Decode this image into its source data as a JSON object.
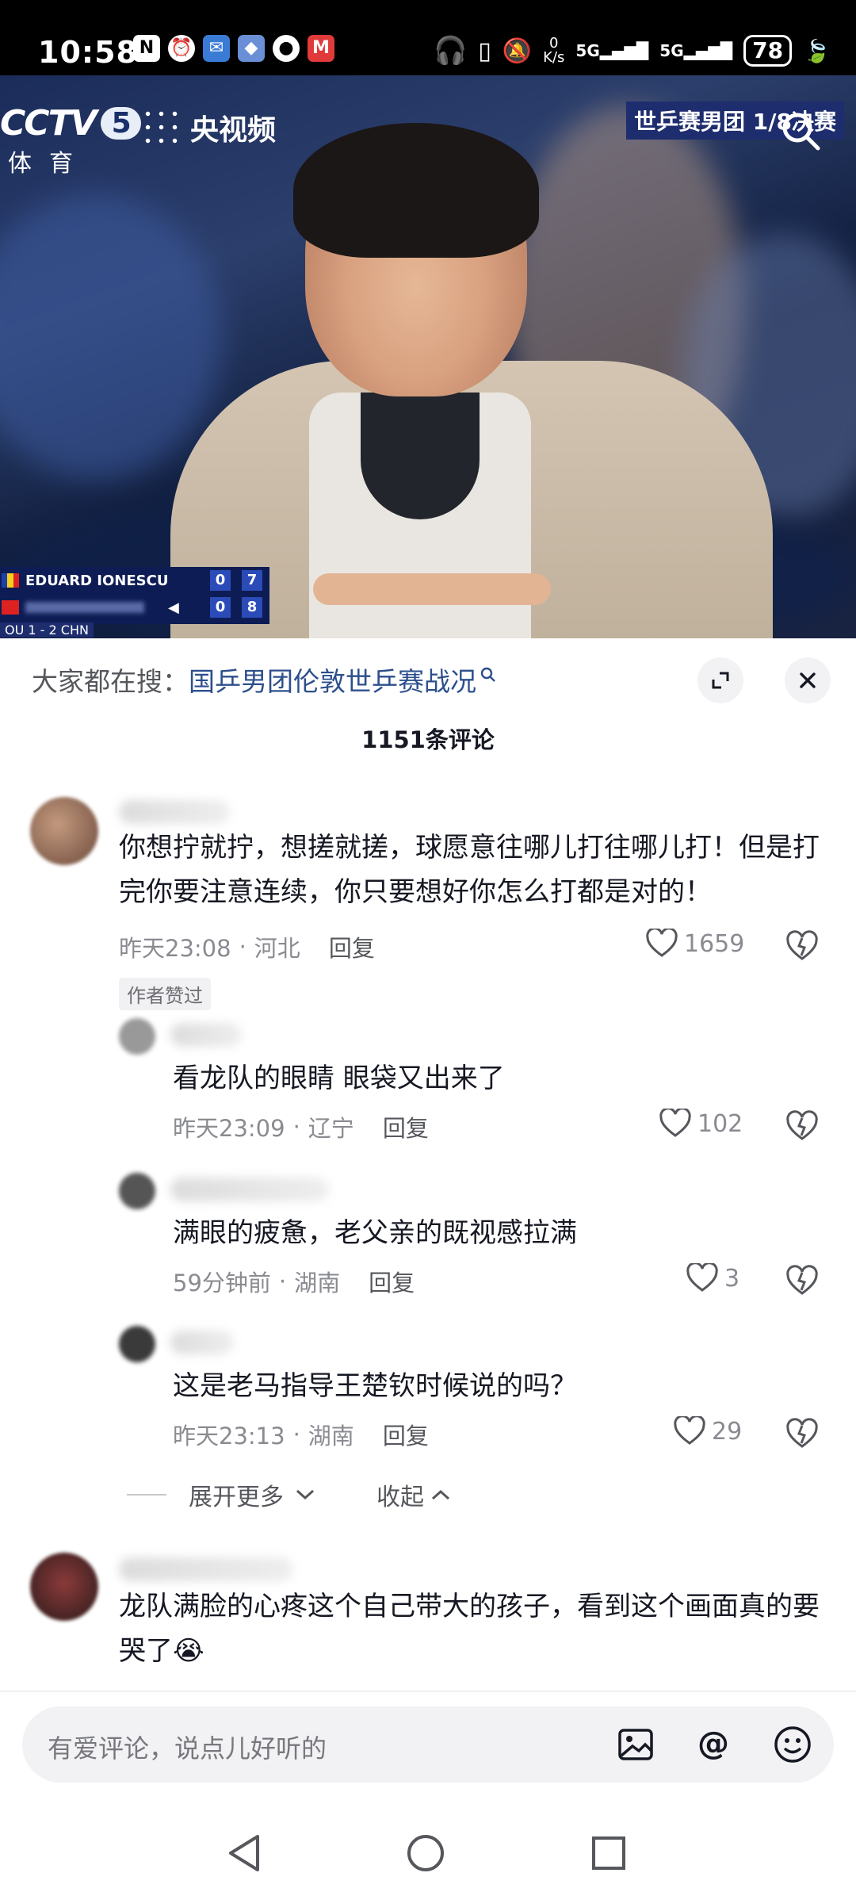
{
  "status_bar": {
    "time": "10:58",
    "network_speed": "0\nK/s",
    "signal1": "5G",
    "signal2": "5G",
    "battery": "78"
  },
  "video": {
    "channel_logo": "CCTV",
    "channel_number": "5",
    "channel_sub": "体育",
    "platform": "央视频",
    "live_banner": "世乒赛男团  1/8决赛",
    "score": {
      "player1": "EDUARD IONESCU",
      "p1_games": "0",
      "p1_points": "7",
      "p2_games": "0",
      "p2_points": "8",
      "match": "OU 1 - 2 CHN"
    }
  },
  "sheet": {
    "trend_prefix": "大家都在搜：",
    "trend_link": "国乒男团伦敦世乒赛战况",
    "comment_count": "1151条评论"
  },
  "comments": [
    {
      "text": "你想拧就拧，想搓就搓，球愿意往哪儿打往哪儿打！但是打完你要注意连续，你只要想好你怎么打都是对的！",
      "time": "昨天23:08",
      "location": "河北",
      "reply_label": "回复",
      "likes": "1659",
      "badge": "作者赞过"
    },
    {
      "text": "看龙队的眼睛 眼袋又出来了",
      "time": "昨天23:09",
      "location": "辽宁",
      "reply_label": "回复",
      "likes": "102"
    },
    {
      "text": "满眼的疲惫，老父亲的既视感拉满",
      "time": "59分钟前",
      "location": "湖南",
      "reply_label": "回复",
      "likes": "3"
    },
    {
      "text": "这是老马指导王楚钦时候说的吗？",
      "time": "昨天23:13",
      "location": "湖南",
      "reply_label": "回复",
      "likes": "29"
    },
    {
      "text": "龙队满脸的心疼这个自己带大的孩子，看到这个画面真的要哭了😭"
    }
  ],
  "thread_controls": {
    "expand_more": "展开更多",
    "collapse": "收起"
  },
  "input": {
    "placeholder": "有爱评论，说点儿好听的"
  }
}
